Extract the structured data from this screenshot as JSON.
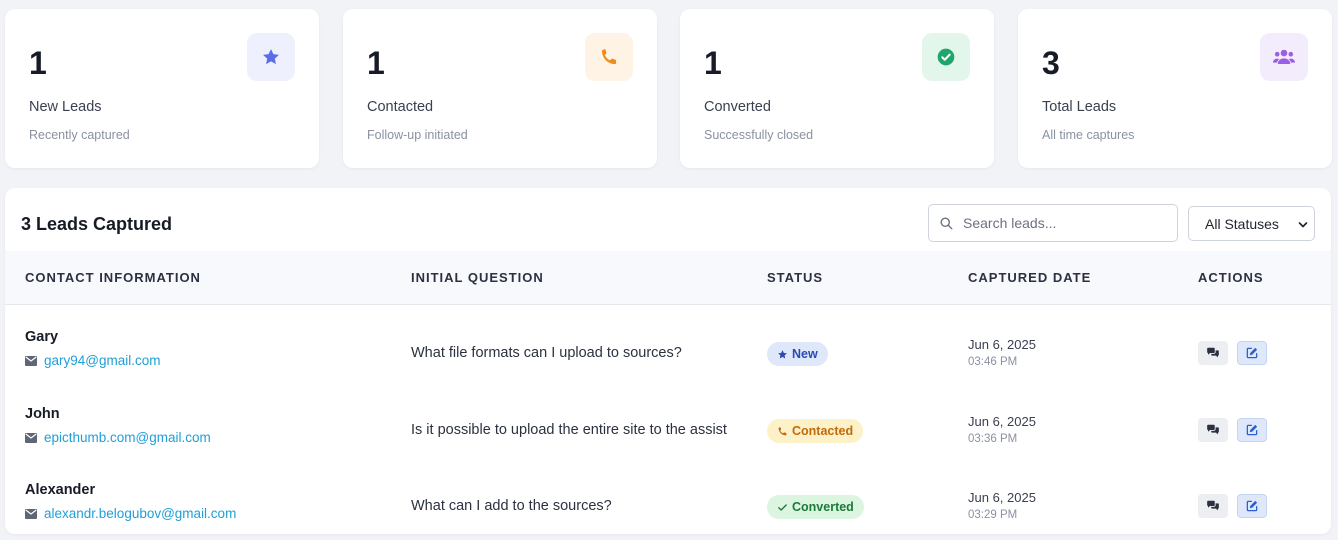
{
  "stats": [
    {
      "value": "1",
      "title": "New Leads",
      "subtitle": "Recently captured",
      "icon": "star-icon",
      "icon_color": "#5b6ee6",
      "icon_bg": "#eef0fd"
    },
    {
      "value": "1",
      "title": "Contacted",
      "subtitle": "Follow-up initiated",
      "icon": "phone-icon",
      "icon_color": "#f08c1a",
      "icon_bg": "#fff3e6"
    },
    {
      "value": "1",
      "title": "Converted",
      "subtitle": "Successfully closed",
      "icon": "check-circle-icon",
      "icon_color": "#1fa66a",
      "icon_bg": "#e3f6ec"
    },
    {
      "value": "3",
      "title": "Total Leads",
      "subtitle": "All time captures",
      "icon": "users-icon",
      "icon_color": "#9b5ee6",
      "icon_bg": "#f3ecfd"
    }
  ],
  "leads": {
    "title": "3 Leads Captured",
    "search_placeholder": "Search leads...",
    "status_filter": "All Statuses",
    "columns": [
      "Contact Information",
      "Initial Question",
      "Status",
      "Captured Date",
      "Actions"
    ],
    "rows": [
      {
        "name": "Gary",
        "email": "gary94@gmail.com",
        "question": "What file formats can I upload to sources?",
        "status": "New",
        "status_key": "new",
        "date": "Jun 6, 2025",
        "time": "03:46 PM"
      },
      {
        "name": "John",
        "email": "epicthumb.com@gmail.com",
        "question": "Is it possible to upload the entire site to the assistant?",
        "status": "Contacted",
        "status_key": "contacted",
        "date": "Jun 6, 2025",
        "time": "03:36 PM"
      },
      {
        "name": "Alexander",
        "email": "alexandr.belogubov@gmail.com",
        "question": "What can I add to the sources?",
        "status": "Converted",
        "status_key": "converted",
        "date": "Jun 6, 2025",
        "time": "03:29 PM"
      }
    ]
  },
  "colors": {
    "link": "#1f9fd6",
    "page_bg": "#f1f3f7"
  }
}
